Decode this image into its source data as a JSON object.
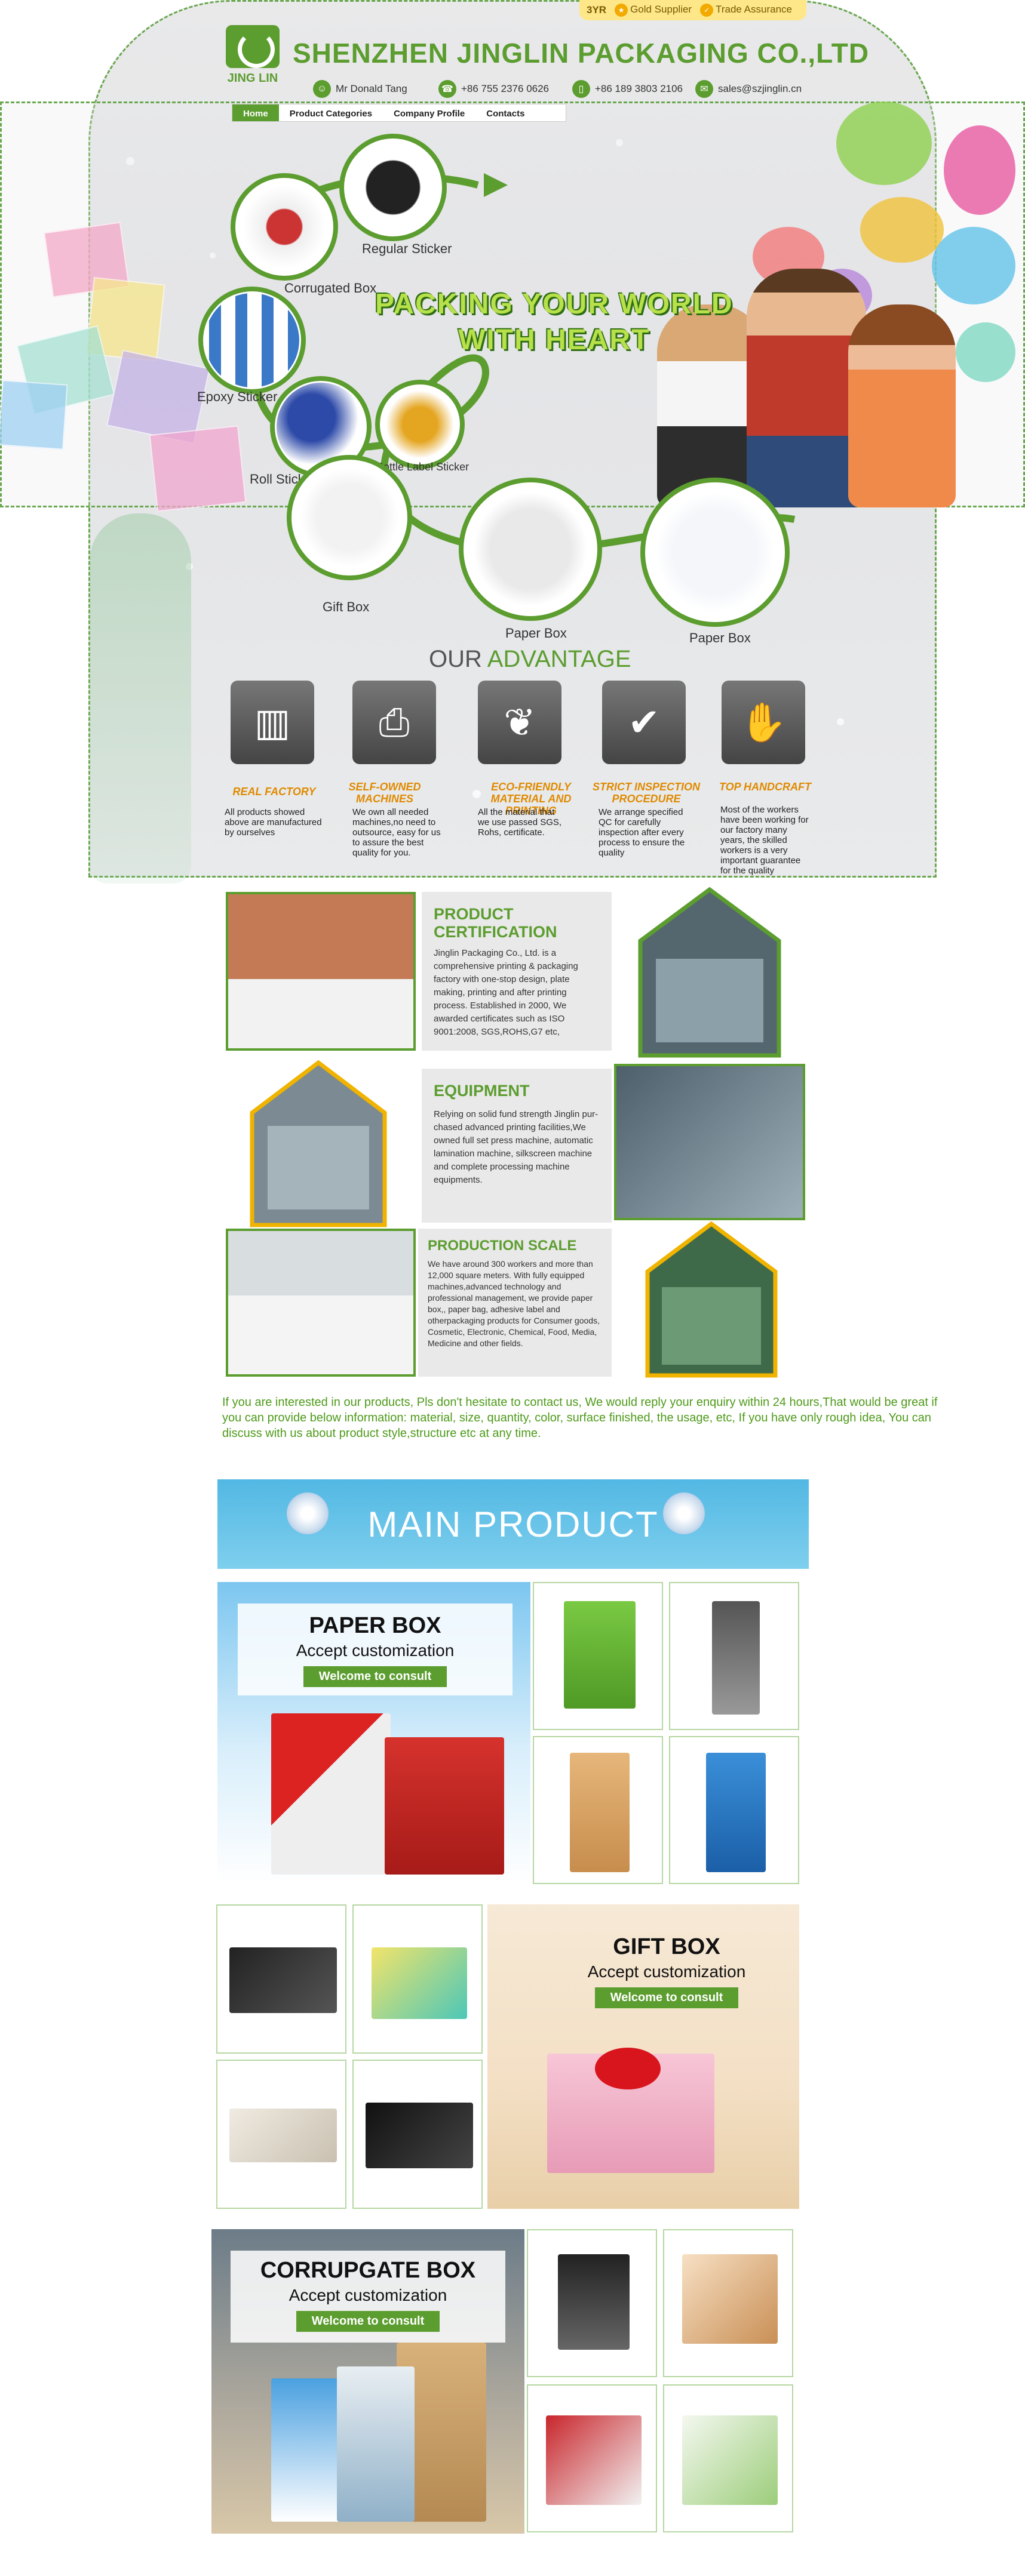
{
  "header": {
    "supplier_years": "3YR",
    "gold_supplier": "Gold Supplier",
    "trade_assurance": "Trade Assurance",
    "logo_text": "JING LIN",
    "company_name": "SHENZHEN JINGLIN PACKAGING CO.,LTD",
    "contact_name": "Mr Donald Tang",
    "phone1": "+86 755 2376 0626",
    "phone2": "+86 189 3803 2106",
    "email": "sales@szjinglin.cn"
  },
  "nav": {
    "home": "Home",
    "categories": "Product Categories",
    "profile": "Company Profile",
    "contacts": "Contacts"
  },
  "hero": {
    "slogan_line1": "PACKING YOUR WORLD",
    "slogan_line2": "WITH HEART",
    "labels": {
      "regular_sticker": "Regular Sticker",
      "corrugated_box": "Corrugated Box",
      "epoxy_sticker": "Epoxy Sticker",
      "roll_sticker": "Roll Sticker",
      "bottle_label": "Bottle Label Sticker",
      "gift_box": "Gift Box",
      "paper_box_1": "Paper Box",
      "paper_box_2": "Paper Box"
    }
  },
  "advantage": {
    "title_prefix": "OUR ",
    "title_highlight": "ADVANTAGE",
    "items": [
      {
        "title": "REAL FACTORY",
        "text": "All products showed above are manufactured by ourselves"
      },
      {
        "title": "SELF-OWNED MACHINES",
        "text": "We own all needed machines,no need to outsource, easy for us to assure the best quality for you."
      },
      {
        "title": "ECO-FRIENDLY MATERIAL AND PRINTING",
        "text": "All the material that we use passed SGS, Rohs, certificate."
      },
      {
        "title": "STRICT INSPECTION PROCEDURE",
        "text": "We arrange specified QC for carefully inspection after every process to ensure the quality"
      },
      {
        "title": "TOP HANDCRAFT",
        "text": "Most of the workers have been working for our factory many years, the skilled workers is a very important guarantee for the quality"
      }
    ]
  },
  "about": {
    "certification": {
      "title": "PRODUCT CERTIFICATION",
      "text": "Jinglin Packaging Co., Ltd. is a comprehensive printing & packaging factory with one-stop design, plate making, printing and after printing process. Established in 2000, We awarded certificates such as ISO 9001:2008, SGS,ROHS,G7 etc,"
    },
    "equipment": {
      "title": "EQUIPMENT",
      "text": "Relying on solid fund strength Jinglin pur-chased advanced printing facilities,We owned full set press machine, automatic lamination machine, silkscreen machine and complete processing machine equipments."
    },
    "production": {
      "title": "PRODUCTION SCALE",
      "text": "We have around 300 workers and more than 12,000 square meters. With fully equipped machines,advanced technology and professional management, we provide paper box,, paper bag, adhesive label and otherpackaging products for Consumer goods, Cosmetic, Electronic, Chemical, Food, Media, Medicine and other fields."
    }
  },
  "inquiry_text": "If you are interested in our products, Pls don't hesitate to contact us, We would reply your enquiry within 24 hours,That would be great if you can provide below information: material, size, quantity, color, surface finished, the usage, etc, If you have only rough idea, You can discuss with us about product style,structure etc at any time.",
  "main_product": {
    "banner": "MAIN PRODUCT",
    "paper_box": {
      "title": "PAPER BOX",
      "subtitle": "Accept customization",
      "button": "Welcome to consult"
    },
    "gift_box": {
      "title": "GIFT BOX",
      "subtitle": "Accept customization",
      "button": "Welcome to consult"
    },
    "corrugate_box": {
      "title": "CORRUPGATE  BOX",
      "subtitle": "Accept customization",
      "button": "Welcome to consult"
    }
  },
  "colors": {
    "brand_green": "#5c9d2f",
    "accent_orange": "#e08a00",
    "banner_blue": "#52b8e3"
  }
}
